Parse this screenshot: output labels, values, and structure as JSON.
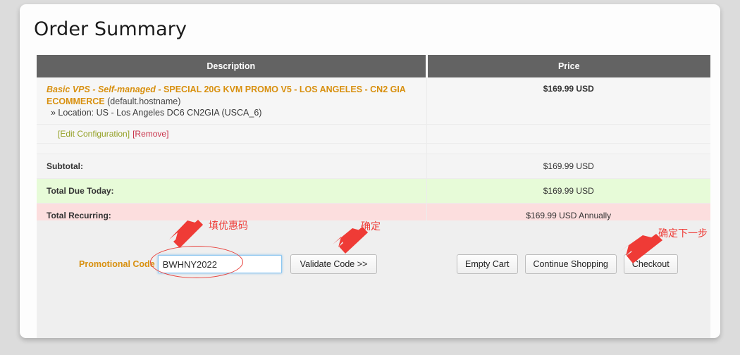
{
  "page": {
    "title": "Order Summary"
  },
  "cart": {
    "headers": [
      "Description",
      "Price"
    ],
    "product": {
      "name_italic": "Basic VPS - Self-managed",
      "name_rest": " - SPECIAL 20G KVM PROMO V5 - LOS ANGELES - CN2 GIA ECOMMERCE",
      "hostname": " (default.hostname)",
      "location": "» Location: US - Los Angeles DC6 CN2GIA (USCA_6)",
      "price": "$169.99 USD",
      "edit_link": "[Edit Configuration]",
      "remove_link": "[Remove]"
    },
    "rows": [
      {
        "label": "Subtotal:",
        "amount": "$169.99 USD",
        "style": "plain"
      },
      {
        "label": "Total Due Today:",
        "amount": "$169.99 USD",
        "style": "green"
      },
      {
        "label": "Total Recurring:",
        "amount": "$169.99 USD Annually",
        "style": "pink"
      }
    ]
  },
  "promo": {
    "label": "Promotional Code",
    "value": "BWHNY2022",
    "placeholder": "",
    "validate_button": "Validate Code >>"
  },
  "actions": {
    "empty_cart": "Empty Cart",
    "continue_shopping": "Continue Shopping",
    "checkout": "Checkout"
  },
  "annotations": {
    "fill_promo": "填优惠码",
    "confirm": "确定",
    "confirm_next": "确定下一步"
  },
  "colors": {
    "accent_gold": "#d8900f",
    "header_gray": "#636363",
    "annotation_red": "#ef3b36",
    "row_green": "#e7fbd8",
    "row_pink": "#fcdede"
  }
}
